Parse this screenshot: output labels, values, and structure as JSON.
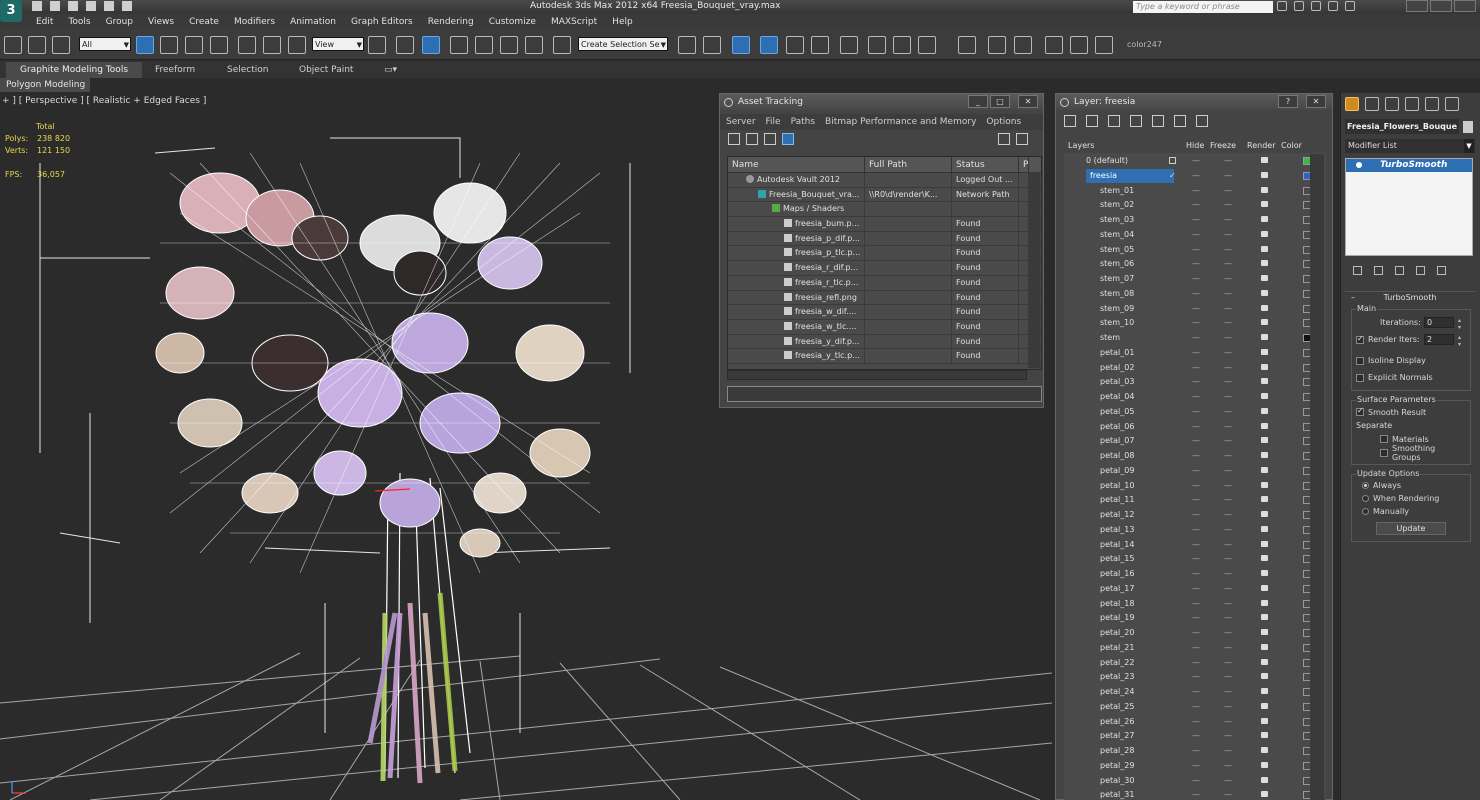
{
  "app": {
    "title": "Autodesk 3ds Max  2012 x64     Freesia_Bouquet_vray.max",
    "logo": "3",
    "help_search_placeholder": "Type a keyword or phrase"
  },
  "menu": [
    "Edit",
    "Tools",
    "Group",
    "Views",
    "Create",
    "Modifiers",
    "Animation",
    "Graph Editors",
    "Rendering",
    "Customize",
    "MAXScript",
    "Help"
  ],
  "toolbar": {
    "selection_filter": "All",
    "reference_coord": "View",
    "named_selection": "Create Selection Se",
    "color_label": "color247"
  },
  "ribbon": {
    "tabs": [
      "Graphite Modeling Tools",
      "Freeform",
      "Selection",
      "Object Paint"
    ],
    "subtab": "Polygon Modeling"
  },
  "viewport": {
    "label": "+ ] [ Perspective ] [ Realistic + Edged Faces ]",
    "stats": {
      "total_label": "Total",
      "polys_label": "Polys:",
      "polys": "238 820",
      "verts_label": "Verts:",
      "verts": "121 150",
      "fps_label": "FPS:",
      "fps": "36,057"
    }
  },
  "asset_tracking": {
    "title": "Asset Tracking",
    "menu": [
      "Server",
      "File",
      "Paths",
      "Bitmap Performance and Memory",
      "Options"
    ],
    "columns": [
      "Name",
      "Full Path",
      "Status",
      "P"
    ],
    "rows": [
      {
        "name": "Autodesk Vault 2012",
        "path": "",
        "status": "Logged Out ...",
        "indent": 0,
        "icon": "vault"
      },
      {
        "name": "Freesia_Bouquet_vra...",
        "path": "\\\\R0\\d\\render\\K...",
        "status": "Network Path",
        "indent": 1,
        "icon": "max"
      },
      {
        "name": "Maps / Shaders",
        "path": "",
        "status": "",
        "indent": 2,
        "icon": "folder"
      },
      {
        "name": "freesia_bum.p...",
        "path": "",
        "status": "Found",
        "indent": 3,
        "icon": "file"
      },
      {
        "name": "freesia_p_dif.p...",
        "path": "",
        "status": "Found",
        "indent": 3,
        "icon": "file"
      },
      {
        "name": "freesia_p_tlc.p...",
        "path": "",
        "status": "Found",
        "indent": 3,
        "icon": "file"
      },
      {
        "name": "freesia_r_dif.p...",
        "path": "",
        "status": "Found",
        "indent": 3,
        "icon": "file"
      },
      {
        "name": "freesia_r_tlc.p...",
        "path": "",
        "status": "Found",
        "indent": 3,
        "icon": "file"
      },
      {
        "name": "freesia_refl.png",
        "path": "",
        "status": "Found",
        "indent": 3,
        "icon": "file"
      },
      {
        "name": "freesia_w_dif....",
        "path": "",
        "status": "Found",
        "indent": 3,
        "icon": "file"
      },
      {
        "name": "freesia_w_tlc....",
        "path": "",
        "status": "Found",
        "indent": 3,
        "icon": "file"
      },
      {
        "name": "freesia_y_dif.p...",
        "path": "",
        "status": "Found",
        "indent": 3,
        "icon": "file"
      },
      {
        "name": "freesia_y_tlc.p...",
        "path": "",
        "status": "Found",
        "indent": 3,
        "icon": "file"
      }
    ]
  },
  "layer_panel": {
    "title": "Layer: freesia",
    "columns": [
      "Layers",
      "Hide",
      "Freeze",
      "Render",
      "Color"
    ],
    "layers": [
      {
        "name": "0 (default)",
        "level": 0,
        "color": "#3bb84a"
      },
      {
        "name": "freesia",
        "level": 0,
        "color": "#2f62c8",
        "selected": true
      },
      {
        "name": "stem_01",
        "level": 1
      },
      {
        "name": "stem_02",
        "level": 1
      },
      {
        "name": "stem_03",
        "level": 1
      },
      {
        "name": "stem_04",
        "level": 1
      },
      {
        "name": "stem_05",
        "level": 1
      },
      {
        "name": "stem_06",
        "level": 1
      },
      {
        "name": "stem_07",
        "level": 1
      },
      {
        "name": "stem_08",
        "level": 1
      },
      {
        "name": "stem_09",
        "level": 1
      },
      {
        "name": "stem_10",
        "level": 1
      },
      {
        "name": "stem",
        "level": 1,
        "color": "#111111"
      },
      {
        "name": "petal_01",
        "level": 1
      },
      {
        "name": "petal_02",
        "level": 1
      },
      {
        "name": "petal_03",
        "level": 1
      },
      {
        "name": "petal_04",
        "level": 1
      },
      {
        "name": "petal_05",
        "level": 1
      },
      {
        "name": "petal_06",
        "level": 1
      },
      {
        "name": "petal_07",
        "level": 1
      },
      {
        "name": "petal_08",
        "level": 1
      },
      {
        "name": "petal_09",
        "level": 1
      },
      {
        "name": "petal_10",
        "level": 1
      },
      {
        "name": "petal_11",
        "level": 1
      },
      {
        "name": "petal_12",
        "level": 1
      },
      {
        "name": "petal_13",
        "level": 1
      },
      {
        "name": "petal_14",
        "level": 1
      },
      {
        "name": "petal_15",
        "level": 1
      },
      {
        "name": "petal_16",
        "level": 1
      },
      {
        "name": "petal_17",
        "level": 1
      },
      {
        "name": "petal_18",
        "level": 1
      },
      {
        "name": "petal_19",
        "level": 1
      },
      {
        "name": "petal_20",
        "level": 1
      },
      {
        "name": "petal_21",
        "level": 1
      },
      {
        "name": "petal_22",
        "level": 1
      },
      {
        "name": "petal_23",
        "level": 1
      },
      {
        "name": "petal_24",
        "level": 1
      },
      {
        "name": "petal_25",
        "level": 1
      },
      {
        "name": "petal_26",
        "level": 1
      },
      {
        "name": "petal_27",
        "level": 1
      },
      {
        "name": "petal_28",
        "level": 1
      },
      {
        "name": "petal_29",
        "level": 1
      },
      {
        "name": "petal_30",
        "level": 1
      },
      {
        "name": "petal_31",
        "level": 1
      }
    ]
  },
  "command_panel": {
    "object_name": "Freesia_Flowers_Bouque",
    "modifier_list": "Modifier List",
    "stack_items": [
      "TurboSmooth"
    ],
    "rollout_title": "TurboSmooth",
    "main_group": "Main",
    "iterations_label": "Iterations:",
    "iterations": "0",
    "render_iters_label": "Render Iters:",
    "render_iters": "2",
    "isoline_label": "Isoline Display",
    "explicit_normals_label": "Explicit Normals",
    "surface_group": "Surface Parameters",
    "smooth_result_label": "Smooth Result",
    "separate_label": "Separate",
    "materials_label": "Materials",
    "smoothing_groups_label": "Smoothing Groups",
    "update_group": "Update Options",
    "always_label": "Always",
    "when_rendering_label": "When Rendering",
    "manually_label": "Manually",
    "update_button": "Update"
  },
  "colors": {
    "accent": "#2d6fb2",
    "stats_text": "#e8d84a",
    "wire": "#ffffff"
  }
}
